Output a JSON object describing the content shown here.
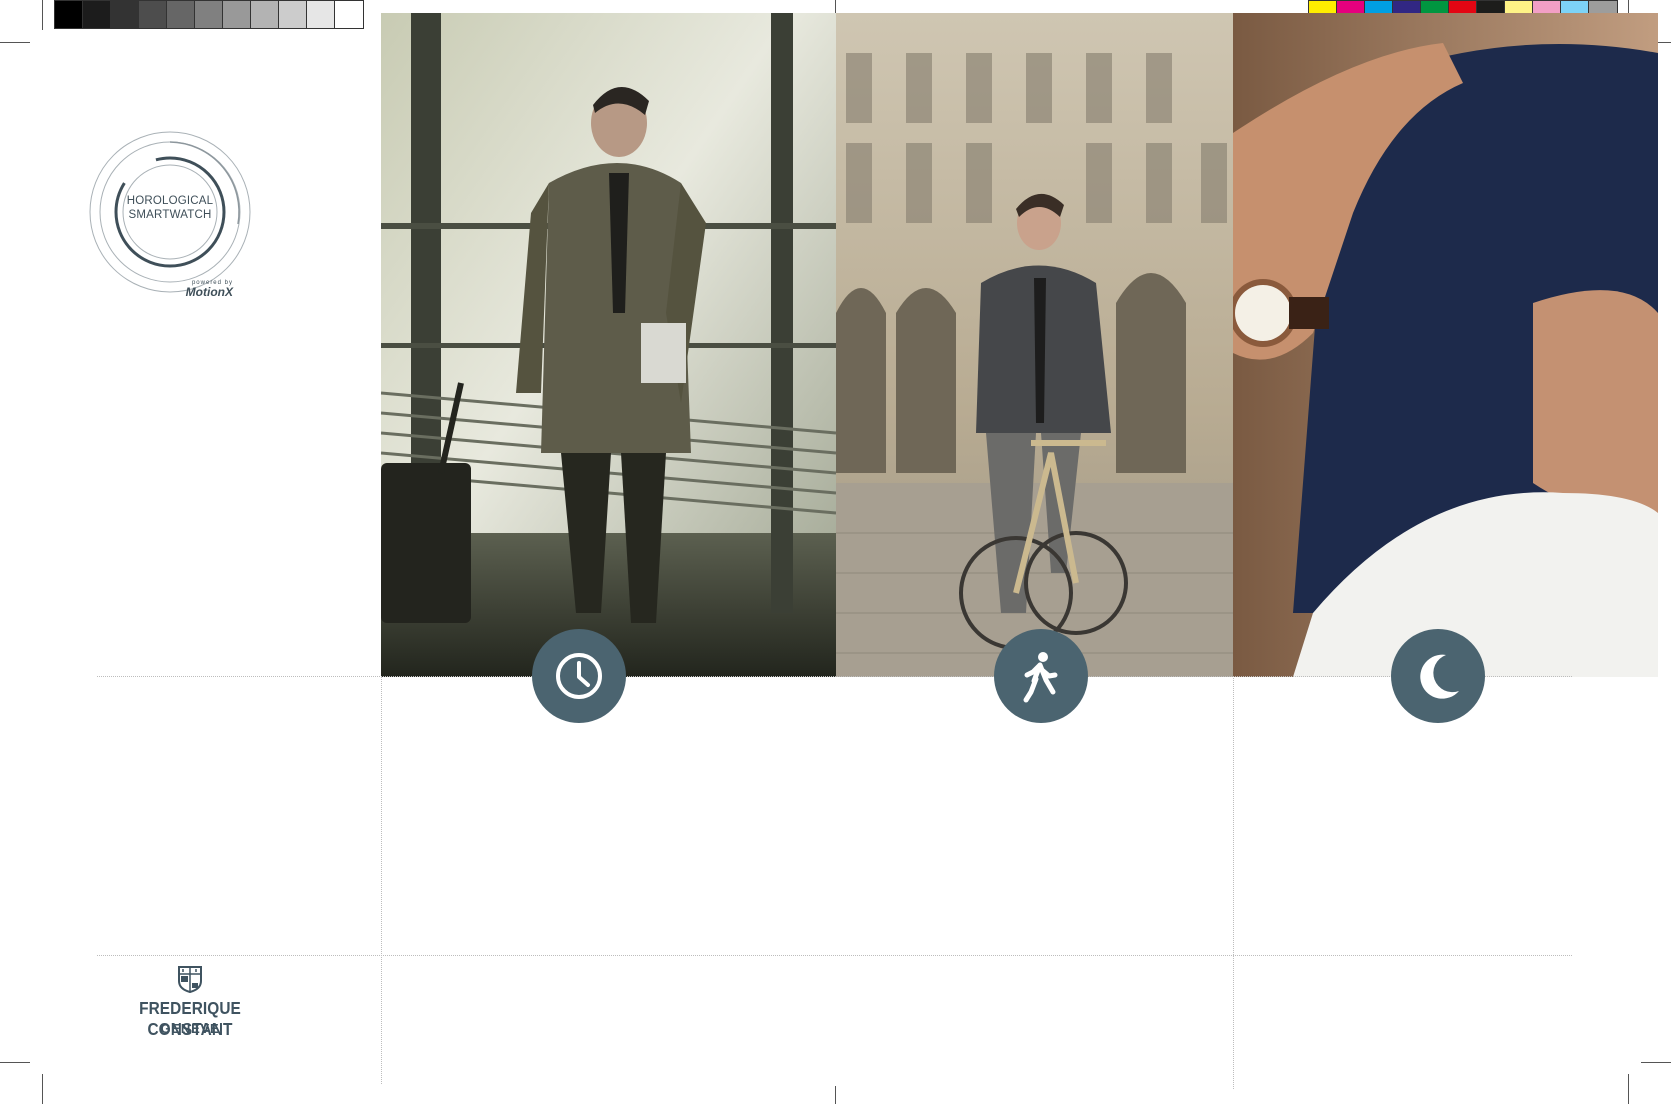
{
  "logo_badge": {
    "line1": "HOROLOGICAL",
    "line2": "SMARTWATCH",
    "powered_by": "powered by",
    "partner": "MotionX"
  },
  "brand": {
    "name": "FREDERIQUE CONSTANT",
    "city": "GENEVE"
  },
  "gray_bar": [
    "#000000",
    "#1c1c1c",
    "#333333",
    "#4d4d4d",
    "#666666",
    "#808080",
    "#999999",
    "#b3b3b3",
    "#cccccc",
    "#e6e6e6",
    "#ffffff"
  ],
  "color_bar": [
    "#ffed00",
    "#e6007e",
    "#009fe3",
    "#312783",
    "#009640",
    "#e30613",
    "#1d1d1b",
    "#fff386",
    "#f29fc5",
    "#7dd3f7",
    "#9d9d9c"
  ],
  "panels": [
    {
      "photo": "businessman-traveler-photo",
      "icon": "clock-icon"
    },
    {
      "photo": "cyclist-photo",
      "icon": "walking-icon"
    },
    {
      "photo": "sleeping-man-photo",
      "icon": "moon-icon"
    }
  ],
  "colors": {
    "accent": "#4b6470",
    "text": "#3f5360"
  }
}
